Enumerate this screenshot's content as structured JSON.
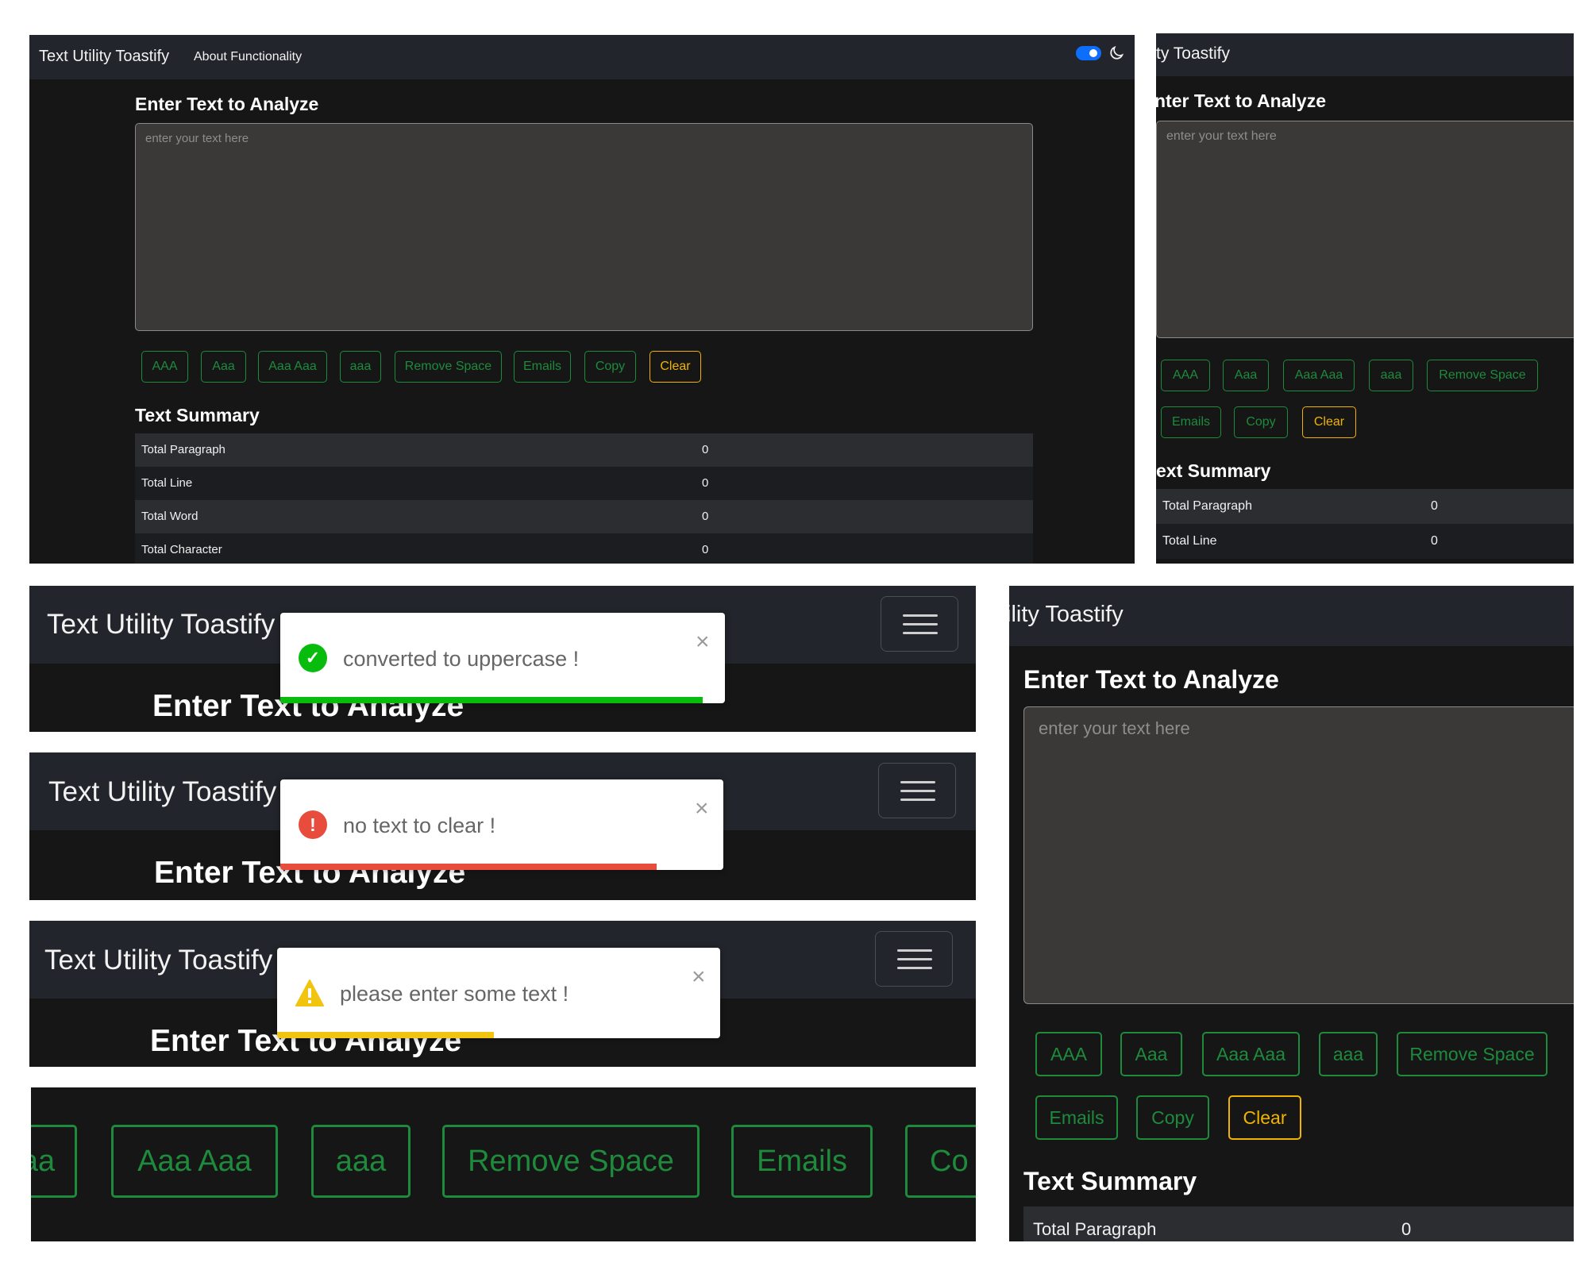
{
  "app": {
    "brand": "Text Utility Toastify",
    "brand_crop_a": "ty Toastify",
    "brand_crop_b": "ility Toastify",
    "nav_about": "About Functionality"
  },
  "editor": {
    "heading": "Enter Text to Analyze",
    "heading_crop": "nter Text to Analyze",
    "placeholder": "enter your text here"
  },
  "buttons": {
    "upper": "AAA",
    "sentence": "Aaa",
    "title": "Aaa Aaa",
    "lower": "aaa",
    "remove_space": "Remove Space",
    "emails": "Emails",
    "copy": "Copy",
    "clear": "Clear",
    "sentence_crop": "aa",
    "copy_crop": "Co"
  },
  "summary": {
    "heading": "Text Summary",
    "heading_crop": "ext Summary",
    "rows": [
      {
        "label": "Total Paragraph",
        "value": "0"
      },
      {
        "label": "Total Line",
        "value": "0"
      },
      {
        "label": "Total Word",
        "value": "0"
      },
      {
        "label": "Total Character",
        "value": "0"
      }
    ]
  },
  "toasts": {
    "success": {
      "message": "converted to uppercase !",
      "close": "×",
      "progress": 0.95,
      "color": "#07bc0c"
    },
    "error": {
      "message": "no text to clear !",
      "close": "×",
      "progress": 0.85,
      "color": "#e74c3c"
    },
    "warning": {
      "message": "please enter some text !",
      "close": "×",
      "progress": 0.49,
      "color": "#f1c40f"
    }
  },
  "colors": {
    "background": "#161616",
    "navbar": "#22252b",
    "button_green": "#1e8a3c",
    "button_clear": "#f0b400",
    "toggle_blue": "#0d6efd"
  },
  "icons": {
    "theme": "moon-icon",
    "menu": "hamburger-menu-icon",
    "success": "check-circle-icon",
    "error": "exclamation-circle-icon",
    "warning": "warning-triangle-icon"
  }
}
